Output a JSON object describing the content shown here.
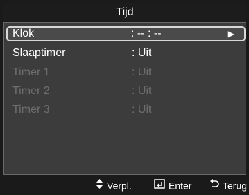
{
  "title": "Tijd",
  "menu": {
    "items": [
      {
        "label": "Klok",
        "value": ": -- : --",
        "state": "selected",
        "has_arrow": true
      },
      {
        "label": "Slaaptimer",
        "value": ": Uit",
        "state": "enabled"
      },
      {
        "label": "Timer 1",
        "value": ": Uit",
        "state": "disabled"
      },
      {
        "label": "Timer 2",
        "value": ": Uit",
        "state": "disabled"
      },
      {
        "label": "Timer 3",
        "value": ": Uit",
        "state": "disabled"
      }
    ],
    "arrow_glyph": "▶"
  },
  "footer": {
    "move_label": "Verpl.",
    "enter_label": "Enter",
    "return_label": "Terug",
    "move_icon": "up-down-arrows-icon",
    "enter_icon": "enter-icon",
    "return_icon": "return-icon"
  },
  "colors": {
    "background": "#1a1a1a",
    "panel": "#3c3c3c",
    "selected_border": "#d8d8d8",
    "enabled_text": "#ffffff",
    "disabled_text": "#6e6e6e"
  }
}
